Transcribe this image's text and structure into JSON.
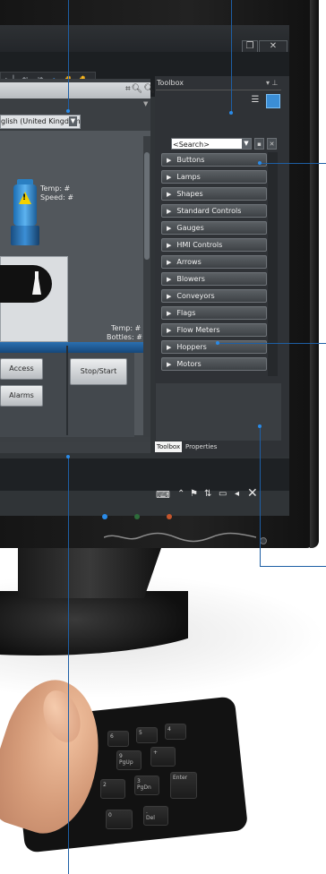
{
  "editor": {
    "language_label": "glish (United Kingdom)",
    "pump_temp": "Temp: #",
    "pump_speed": "Speed: #",
    "machine_temp": "Temp: #",
    "machine_bottles": "Bottles: #",
    "buttons": {
      "access": "Access",
      "stop_start": "Stop/Start",
      "alarms": "Alarms"
    }
  },
  "toolbox": {
    "title": "Toolbox",
    "pin": "▾ ⊥",
    "search_placeholder": "<Search>",
    "categories": [
      "Buttons",
      "Lamps",
      "Shapes",
      "Standard Controls",
      "Gauges",
      "HMI Controls",
      "Arrows",
      "Blowers",
      "Conveyors",
      "Flags",
      "Flow Meters",
      "Hoppers",
      "Motors"
    ],
    "tabs": {
      "toolbox": "Toolbox",
      "properties": "Properties"
    }
  },
  "keyboard": {
    "keys": [
      "PgUp",
      "PgDn",
      "Enter",
      "Del"
    ],
    "digits": [
      "9",
      "3",
      "2",
      "1",
      "0",
      "6",
      "5",
      "4"
    ]
  },
  "colors": {
    "accent": "#2a8be8",
    "callout_line": "#1e5fa5",
    "panel_dark": "#2f3236",
    "pump_blue": "#1c6fb5",
    "warning_yellow": "#f5d100"
  }
}
